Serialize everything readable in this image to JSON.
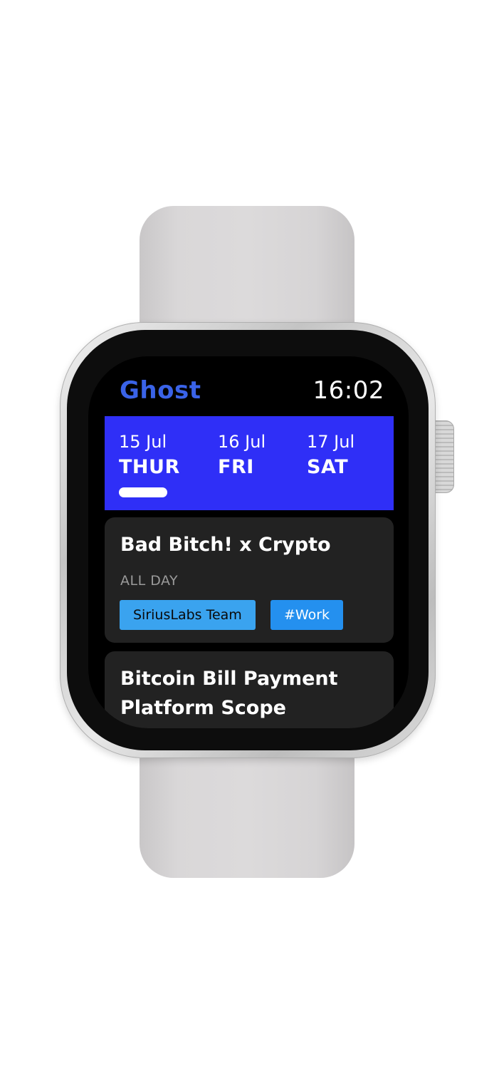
{
  "app": {
    "title": "Ghost",
    "time": "16:02"
  },
  "days": [
    {
      "date": "15 Jul",
      "weekday": "THUR",
      "selected": true
    },
    {
      "date": "16 Jul",
      "weekday": "FRI",
      "selected": false
    },
    {
      "date": "17 Jul",
      "weekday": "SAT",
      "selected": false
    }
  ],
  "events": [
    {
      "title": "Bad Bitch! x Crypto",
      "time": "ALL DAY",
      "tags": [
        "SiriusLabs Team",
        "#Work"
      ]
    },
    {
      "title": "Bitcoin Bill Payment Platform Scope"
    }
  ],
  "colors": {
    "accent_title": "#3a63e8",
    "date_strip": "#2f2ff7",
    "card": "#222222",
    "tag_team": "#3aa3ef",
    "tag_work": "#2490ef"
  }
}
